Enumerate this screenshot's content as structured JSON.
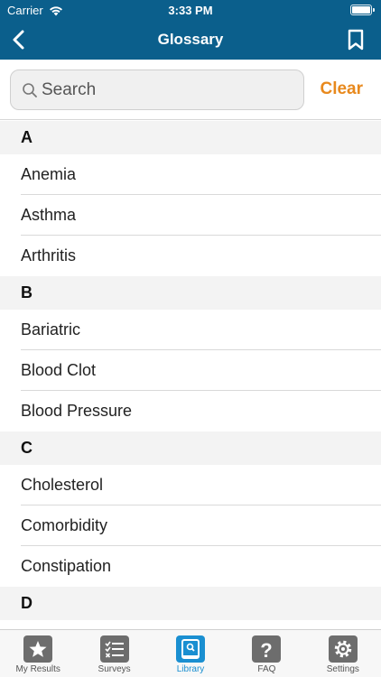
{
  "status_bar": {
    "carrier": "Carrier",
    "time": "3:33 PM"
  },
  "nav": {
    "title": "Glossary",
    "back_icon": "chevron-left-icon",
    "bookmark_icon": "bookmark-icon"
  },
  "search": {
    "placeholder": "Search",
    "value": "",
    "clear_label": "Clear"
  },
  "colors": {
    "header_blue": "#0b5f8c",
    "clear_orange": "#e8891d",
    "active_tab": "#1a8fd1"
  },
  "sections": [
    {
      "letter": "A",
      "items": [
        "Anemia",
        "Asthma",
        "Arthritis"
      ]
    },
    {
      "letter": "B",
      "items": [
        "Bariatric",
        "Blood Clot",
        "Blood Pressure"
      ]
    },
    {
      "letter": "C",
      "items": [
        "Cholesterol",
        "Comorbidity",
        "Constipation"
      ]
    },
    {
      "letter": "D",
      "items": []
    }
  ],
  "tabs": [
    {
      "label": "My Results",
      "icon": "star-icon",
      "active": false
    },
    {
      "label": "Surveys",
      "icon": "checklist-icon",
      "active": false
    },
    {
      "label": "Library",
      "icon": "library-book-icon",
      "active": true
    },
    {
      "label": "FAQ",
      "icon": "question-icon",
      "active": false
    },
    {
      "label": "Settings",
      "icon": "gear-icon",
      "active": false
    }
  ]
}
